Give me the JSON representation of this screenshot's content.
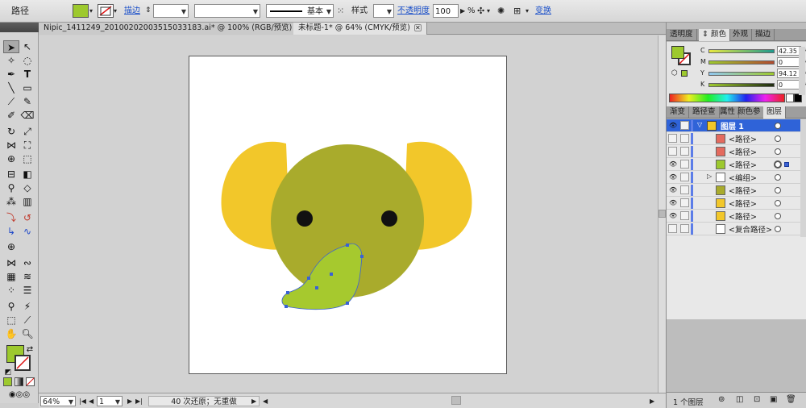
{
  "control_bar": {
    "selection_type": "路径",
    "fill_color": "#9dc92e",
    "stroke_label": "描边",
    "stroke_weight_value": "",
    "stroke_style_label": "基本",
    "style_label": "样式",
    "opacity_label": "不透明度",
    "opacity_value": "100",
    "opacity_unit": "%",
    "transform_label": "变换"
  },
  "tabs": [
    {
      "label": "Nipic_1411249_20100202003515033183.ai* @ 100% (RGB/预览)"
    },
    {
      "label": "未标题-1* @ 64% (CMYK/预览)"
    }
  ],
  "tools": {
    "fill_swatch": "#9dc92e"
  },
  "status_bar": {
    "zoom_value": "64%",
    "artboard_value": "1",
    "undo_text": "40 次还原；无重做"
  },
  "color_panel": {
    "tabs": [
      "透明度",
      "颜色",
      "外观",
      "描边"
    ],
    "active_tab": "颜色",
    "fill_color": "#9dc92e",
    "channels": [
      {
        "label": "C",
        "value": "42.35"
      },
      {
        "label": "M",
        "value": "0"
      },
      {
        "label": "Y",
        "value": "94.12"
      },
      {
        "label": "K",
        "value": "0"
      }
    ],
    "percent": "%"
  },
  "layers_panel": {
    "tabs": [
      "渐变",
      "路径查",
      "属性",
      "颜色参",
      "图层"
    ],
    "active_tab": "图层",
    "layer_name": "图层 1",
    "items": [
      {
        "name": "<路径>",
        "color": "#e46a5e",
        "visible": false,
        "expandable": false,
        "selected": false
      },
      {
        "name": "<路径>",
        "color": "#e46a5e",
        "visible": false,
        "expandable": false,
        "selected": false
      },
      {
        "name": "<路径>",
        "color": "#9dc92e",
        "visible": true,
        "expandable": false,
        "selected": true
      },
      {
        "name": "<编组>",
        "color": "#ffffff",
        "visible": true,
        "expandable": true,
        "selected": false
      },
      {
        "name": "<路径>",
        "color": "#a9ab2c",
        "visible": true,
        "expandable": false,
        "selected": false
      },
      {
        "name": "<路径>",
        "color": "#f2c72a",
        "visible": true,
        "expandable": false,
        "selected": false
      },
      {
        "name": "<路径>",
        "color": "#f2c72a",
        "visible": true,
        "expandable": false,
        "selected": false
      },
      {
        "name": "<复合路径>",
        "color": "#ffffff",
        "visible": false,
        "expandable": false,
        "selected": false
      }
    ],
    "footer_label": "1 个图层"
  },
  "artwork": {
    "ear_color": "#f2c72a",
    "head_color": "#a9ab2c",
    "trunk_color": "#a6c92e",
    "eye_color": "#111111",
    "selection_color": "#3a62d4"
  }
}
